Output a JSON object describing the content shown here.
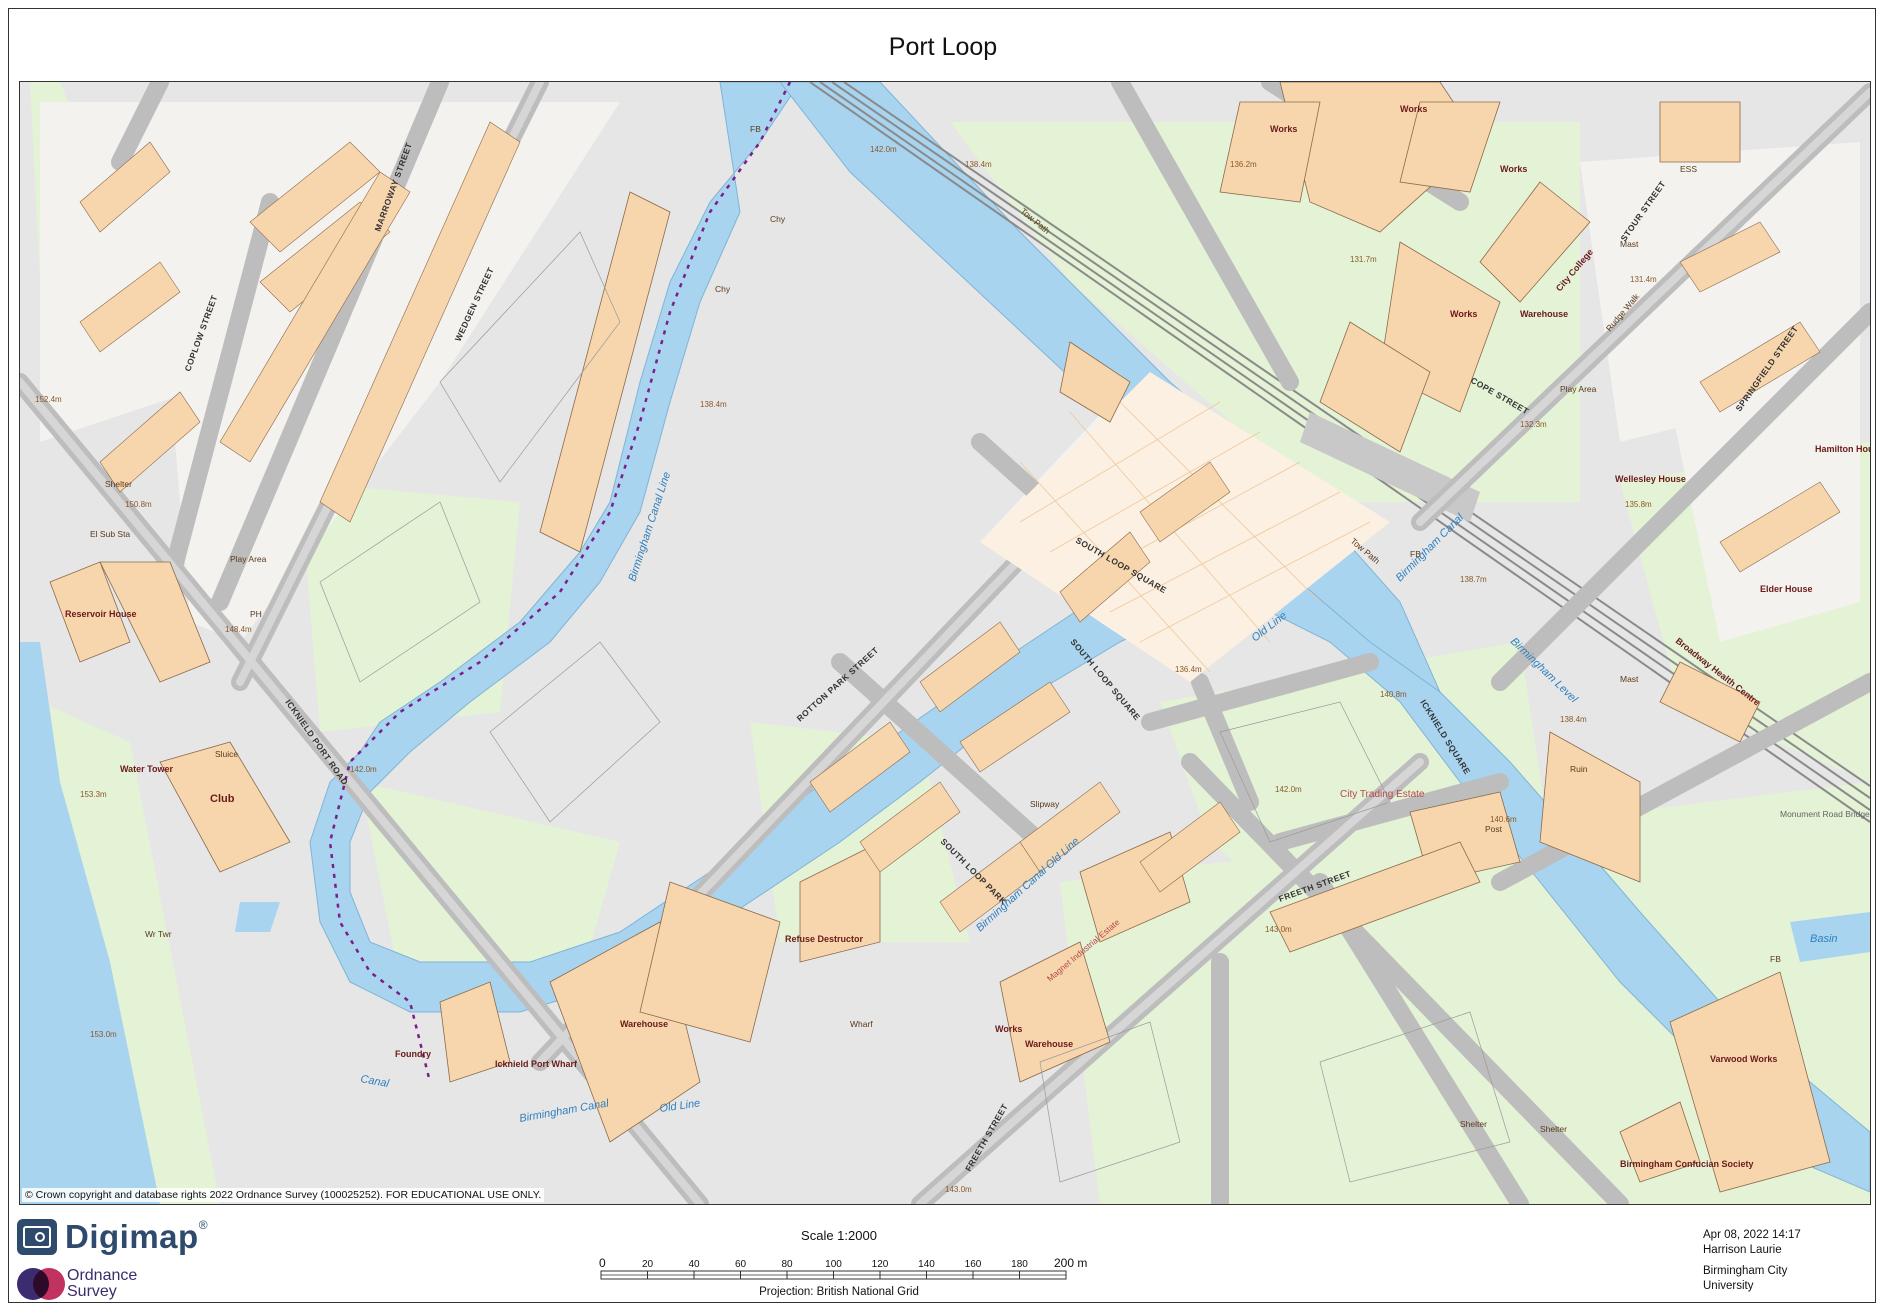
{
  "page": {
    "title": "Port Loop"
  },
  "map": {
    "copyright": "© Crown copyright and database rights 2022 Ordnance Survey (100025252). FOR EDUCATIONAL USE ONLY.",
    "colors": {
      "water": "#a8d4ef",
      "building": "#f7d6ad",
      "road": "#b8b8b8",
      "land": "#e6e6e6",
      "green": "#e4f2d6",
      "rail": "#8a8a8a",
      "route": "#7a1f8a"
    },
    "water_labels": [
      "Birmingham Canal Line",
      "Birmingham Canal",
      "Birmingham Level",
      "Old Line",
      "Birmingham Canal Old Line",
      "Birmingham Canal",
      "Old Line",
      "Canal",
      "Tow Path",
      "Tow Path",
      "Basin"
    ],
    "road_labels": [
      "ICKNIELD PORT ROAD",
      "ROTTON PARK STREET",
      "SOUTH LOOP SQUARE",
      "SOUTH LOOP SQUARE",
      "SOUTH LOOP PARK",
      "ICKNIELD SQUARE",
      "FREETH STREET",
      "FREETH STREET",
      "COPE STREET",
      "SPRINGFIELD STREET",
      "COPLOW STREET",
      "MARROWAY STREET",
      "WEDGEN STREET",
      "Rudge Walk",
      "STOUR STREET"
    ],
    "building_labels": [
      "Works",
      "Works",
      "Works",
      "Works",
      "Works",
      "Warehouse",
      "City College",
      "Club",
      "Reservoir House",
      "Water Tower",
      "Warehouse",
      "Refuse Destructor",
      "Warehouse",
      "Icknield Port Wharf",
      "Foundry",
      "Varwood Works",
      "Birmingham Confucian Society",
      "City Trading Estate",
      "Magnet Industrial Estate",
      "Broadway Health Centre",
      "Elder House",
      "Wellesley House",
      "Hamilton House",
      "Ruin",
      "Shelter",
      "Shelter",
      "Shelter",
      "Play Area",
      "Play Area",
      "Slipway",
      "Monument Road Bridge",
      "Mast",
      "Mast",
      "Wharf",
      "El Sub Sta",
      "ESS",
      "FB",
      "FB",
      "FB",
      "Chy",
      "Chy",
      "Sluice",
      "PH",
      "Wr Twr",
      "Post"
    ],
    "spot_heights": [
      "142.0m",
      "138.4m",
      "138.4m",
      "136.2m",
      "131.7m",
      "131.4m",
      "132.3m",
      "135.8m",
      "152.4m",
      "150.8m",
      "148.4m",
      "142.0m",
      "153.3m",
      "153.0m",
      "138.7m",
      "138.4m",
      "140.8m",
      "142.0m",
      "140.6m",
      "143.0m",
      "143.0m",
      "136.4m"
    ]
  },
  "footer": {
    "digimap": "Digimap",
    "digimap_reg": "®",
    "os_line1": "Ordnance",
    "os_line2": "Survey",
    "scale_title": "Scale 1:2000",
    "scale_ticks": [
      "0",
      "20",
      "40",
      "60",
      "80",
      "100",
      "120",
      "140",
      "160",
      "180",
      "200 m"
    ],
    "projection": "Projection: British National Grid",
    "date": "Apr 08, 2022 14:17",
    "author": "Harrison Laurie",
    "org_line1": "Birmingham City",
    "org_line2": "University"
  }
}
